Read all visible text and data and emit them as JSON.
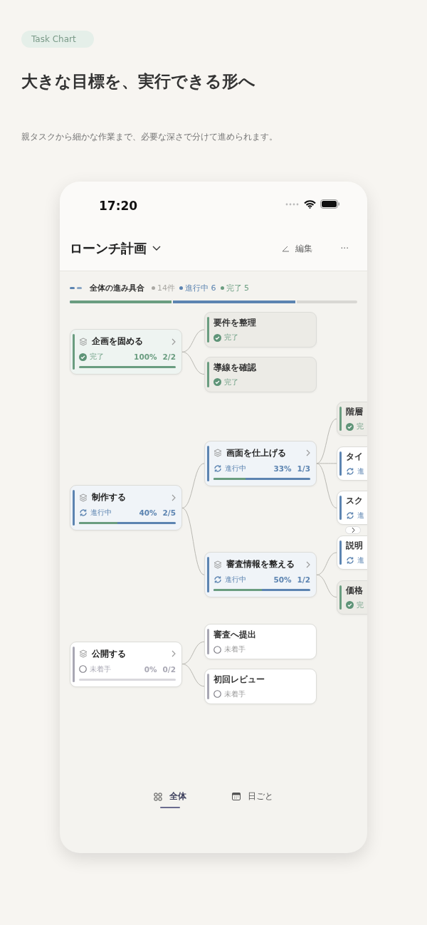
{
  "badge": "Task Chart",
  "headline": "大きな目標を、実行できる形へ",
  "subtitle": "親タスクから細かな作業まで、必要な深さで分けて進められます。",
  "phone": {
    "status_bar": {
      "time": "17:20"
    },
    "header": {
      "title": "ローンチ計画",
      "edit": "編集",
      "more": "···"
    },
    "overview": {
      "label": "全体の進み具合",
      "stats": [
        {
          "text": "14件",
          "color": "#a9a8a3"
        },
        {
          "text": "進行中 6",
          "color": "#5c84b1"
        },
        {
          "text": "完了 5",
          "color": "#6a9d80"
        }
      ],
      "segments": [
        {
          "color": "#6a9d80",
          "level": 0.36
        },
        {
          "color": "#5c84b1",
          "level": 0.79
        }
      ]
    },
    "tree": [
      {
        "kind": "group",
        "title": "企画を固める",
        "done": true,
        "in_progress": false,
        "status_label": "完了",
        "percent": "100%",
        "count": "2/2",
        "level": 1,
        "children": [
          {
            "kind": "task",
            "title": "要件を整理",
            "done": true,
            "in_progress": false,
            "status_label": "完了"
          },
          {
            "kind": "task",
            "title": "導線を確認",
            "done": true,
            "in_progress": false,
            "status_label": "完了"
          }
        ]
      },
      {
        "kind": "group",
        "title": "制作する",
        "done": false,
        "in_progress": true,
        "status_label": "進行中",
        "percent": "40%",
        "count": "2/5",
        "level": 0.4,
        "children": [
          {
            "kind": "group",
            "title": "画面を仕上げる",
            "done": false,
            "in_progress": true,
            "status_label": "進行中",
            "percent": "33%",
            "count": "1/3",
            "level": 0.33,
            "children": [
              {
                "kind": "task",
                "title": "階層",
                "done": true,
                "in_progress": false,
                "status_label": "完"
              },
              {
                "kind": "task",
                "title": "タイ",
                "done": false,
                "in_progress": true,
                "status_label": "進"
              },
              {
                "kind": "task",
                "title": "スク",
                "done": false,
                "in_progress": true,
                "status_label": "進"
              }
            ]
          },
          {
            "kind": "group",
            "title": "審査情報を整える",
            "done": false,
            "in_progress": true,
            "status_label": "進行中",
            "percent": "50%",
            "count": "1/2",
            "level": 0.5,
            "children": [
              {
                "kind": "task",
                "title": "説明",
                "done": false,
                "in_progress": true,
                "status_label": "進"
              },
              {
                "kind": "task",
                "title": "価格",
                "done": true,
                "in_progress": false,
                "status_label": "完"
              }
            ]
          }
        ]
      },
      {
        "kind": "group",
        "title": "公開する",
        "done": false,
        "in_progress": false,
        "status_label": "未着手",
        "percent": "0%",
        "count": "0/2",
        "level": 0,
        "children": [
          {
            "kind": "task",
            "title": "審査へ提出",
            "done": false,
            "in_progress": false,
            "status_label": "未着手"
          },
          {
            "kind": "task",
            "title": "初回レビュー",
            "done": false,
            "in_progress": false,
            "status_label": "未着手"
          }
        ]
      }
    ],
    "tabs": [
      {
        "label": "全体",
        "selected": true
      },
      {
        "label": "日ごと",
        "selected": false
      }
    ]
  }
}
